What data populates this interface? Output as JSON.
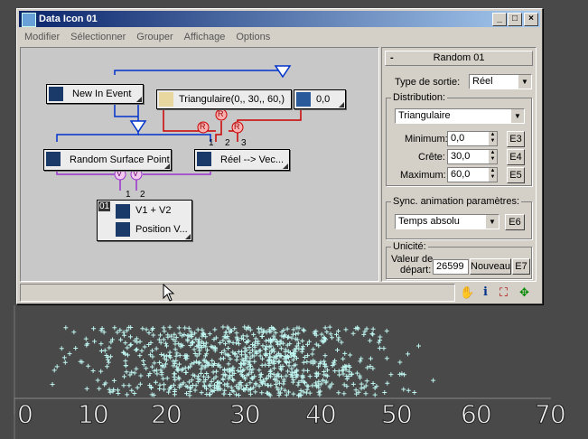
{
  "window": {
    "title": "Data Icon 01",
    "min": "_",
    "max": "□",
    "close": "×"
  },
  "menu": [
    "Modifier",
    "Sélectionner",
    "Grouper",
    "Affichage",
    "Options"
  ],
  "nodes": {
    "new_in_event": "New In Event",
    "triangulaire": "Triangulaire(0,, 30,, 60,)",
    "constant": "0,0",
    "random_surface_point": "Random Surface Point",
    "reel_vec": "Réel --> Vec...",
    "expr_number": "01",
    "expr_line1": "V1 + V2",
    "expr_line2": "Position V...",
    "pin_labels": {
      "p1": "1",
      "p2": "2",
      "p3": "3",
      "q1": "1",
      "q2": "2"
    },
    "junction_r": "R",
    "junction_v": "V"
  },
  "panel": {
    "title": "Random 01",
    "collapse": "-",
    "type_label": "Type de sortie:",
    "type_value": "Réel",
    "distribution_label": "Distribution:",
    "distribution_value": "Triangulaire",
    "min_label": "Minimum:",
    "min_value": "0,0",
    "min_btn": "E3",
    "crete_label": "Crête:",
    "crete_value": "30,0",
    "crete_btn": "E4",
    "max_label": "Maximum:",
    "max_value": "60,0",
    "max_btn": "E5",
    "sync_label": "Sync. animation paramètres:",
    "sync_value": "Temps absolu",
    "sync_btn": "E6",
    "unicite_label": "Unicité:",
    "seed_label_1": "Valeur de",
    "seed_label_2": "départ:",
    "seed_value": "26599",
    "new_btn": "Nouveau",
    "seed_btn": "E7"
  },
  "status_icons": [
    "hand-icon",
    "info-icon",
    "select-icon",
    "navigate-icon"
  ],
  "axis_ticks": [
    "0",
    "10",
    "20",
    "30",
    "40",
    "50",
    "60",
    "70"
  ]
}
